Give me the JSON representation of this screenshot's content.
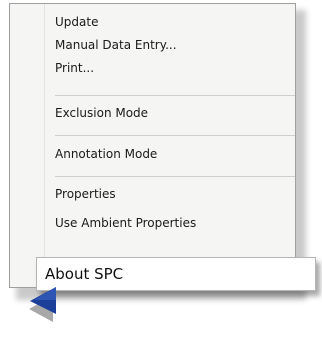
{
  "menu": {
    "items": [
      {
        "label": "Update"
      },
      {
        "label": "Manual Data Entry..."
      },
      {
        "label": "Print..."
      },
      {
        "label": "Exclusion Mode"
      },
      {
        "label": "Annotation Mode"
      },
      {
        "label": "Properties"
      },
      {
        "label": "Use Ambient Properties"
      }
    ],
    "highlighted_item": {
      "label": "About SPC"
    }
  },
  "icons": {
    "cursor": "pointer-arrow-icon"
  }
}
